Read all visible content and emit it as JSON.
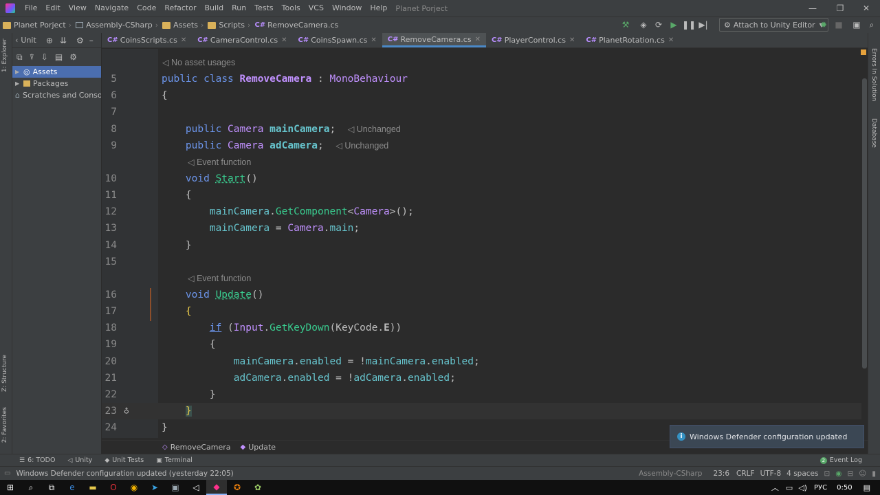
{
  "menu": [
    "File",
    "Edit",
    "View",
    "Navigate",
    "Code",
    "Refactor",
    "Build",
    "Run",
    "Tests",
    "Tools",
    "VCS",
    "Window",
    "Help"
  ],
  "project_title": "Planet Porject",
  "window_controls": [
    "—",
    "❐",
    "✕"
  ],
  "nav": {
    "crumbs": [
      "Planet Porject",
      "Assembly-CSharp",
      "Assets",
      "Scripts",
      "RemoveCamera.cs"
    ],
    "attach_label": "Attach to Unity Editor"
  },
  "left_stripe": {
    "explorer": "1: Explorer",
    "structure": "Z: Structure",
    "favorites": "2: Favorites"
  },
  "right_stripe": {
    "errors": "Errors In Solution",
    "database": "Database"
  },
  "explorer": {
    "header": "Unit",
    "items": [
      {
        "label": "Assets"
      },
      {
        "label": "Packages"
      },
      {
        "label": "Scratches and Consoles"
      }
    ]
  },
  "tabs": [
    {
      "label": "CoinsScripts.cs"
    },
    {
      "label": "CameraControl.cs"
    },
    {
      "label": "CoinsSpawn.cs"
    },
    {
      "label": "RemoveCamera.cs"
    },
    {
      "label": "PlayerControl.cs"
    },
    {
      "label": "PlanetRotation.cs"
    }
  ],
  "code": {
    "hint_no_usages": "No asset usages",
    "hint_event": "Event function",
    "hint_unchanged": "Unchanged",
    "line_numbers": [
      "5",
      "6",
      "7",
      "8",
      "9",
      "10",
      "11",
      "12",
      "13",
      "14",
      "15",
      "16",
      "17",
      "18",
      "19",
      "20",
      "21",
      "22",
      "23",
      "24"
    ],
    "t_public": "public",
    "t_class": "class",
    "t_classname": "RemoveCamera",
    "t_colon": " : ",
    "t_base": "MonoBehaviour",
    "t_brace_open": "{",
    "t_brace_close": "}",
    "t_camera": "Camera",
    "t_main_camera": "mainCamera",
    "t_ad_camera": "adCamera",
    "t_semicolon": ";",
    "t_void": "void",
    "t_start": "Start",
    "t_update": "Update",
    "t_parens": "()",
    "t_dot": ".",
    "t_get_component": "GetComponent",
    "t_generic_open": "<",
    "t_generic_close": ">();",
    "t_assign": " = ",
    "t_main": "main",
    "t_if": "if",
    "t_if_open": " (",
    "t_input": "Input",
    "t_get_key_down": "GetKeyDown",
    "t_paren_open": "(",
    "t_keycode": "KeyCode",
    "t_e": "E",
    "t_close_close": "))",
    "t_enabled": "enabled",
    "t_not": "!"
  },
  "code_breadcrumb": [
    "RemoveCamera",
    "Update"
  ],
  "notification": "Windows Defender configuration updated",
  "bottom_tools": [
    {
      "label": "6: TODO"
    },
    {
      "label": "Unity"
    },
    {
      "label": "Unit Tests"
    },
    {
      "label": "Terminal"
    }
  ],
  "event_log": "Event Log",
  "status": {
    "message": "Windows Defender configuration updated (yesterday 22:05)",
    "assembly": "Assembly-CSharp",
    "position": "23:6",
    "line_sep": "CRLF",
    "encoding": "UTF-8",
    "indent": "4 spaces"
  },
  "taskbar": {
    "lang": "РУС",
    "time": "0:50"
  }
}
